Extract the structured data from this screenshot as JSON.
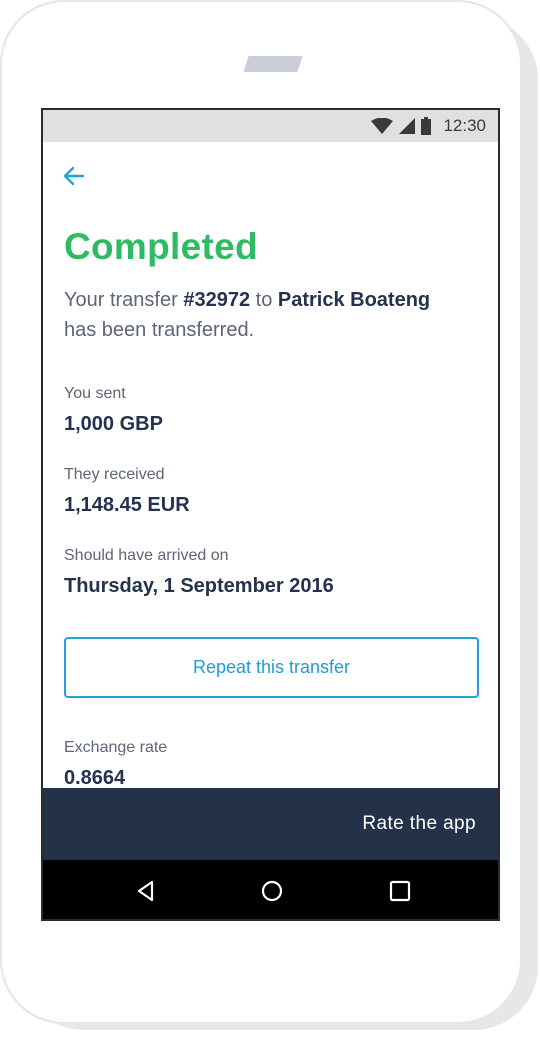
{
  "status_bar": {
    "time": "12:30",
    "icons": [
      "wifi-icon",
      "cell-signal-icon",
      "battery-icon"
    ]
  },
  "header": {
    "back_icon": "arrow-left-icon"
  },
  "transfer": {
    "status": "Completed",
    "desc_prefix": "Your transfer ",
    "transfer_id": "#32972",
    "desc_to": " to ",
    "recipient": "Patrick Boateng",
    "desc_suffix": " has been transferred."
  },
  "details": {
    "sent_label": "You sent",
    "sent_value": "1,000 GBP",
    "received_label": "They received",
    "received_value": "1,148.45 EUR",
    "arrival_label": "Should have arrived on",
    "arrival_value": "Thursday, 1 September 2016",
    "rate_label": "Exchange rate",
    "rate_value": "0.8664"
  },
  "actions": {
    "repeat_label": "Repeat this transfer",
    "rate_app_label": "Rate the app"
  },
  "nav": {
    "icons": [
      "nav-back-icon",
      "nav-home-icon",
      "nav-recents-icon"
    ]
  },
  "colors": {
    "success": "#2ebb63",
    "accent": "#1fa3d8",
    "navy": "#23334f",
    "rate_bar": "#243249"
  }
}
